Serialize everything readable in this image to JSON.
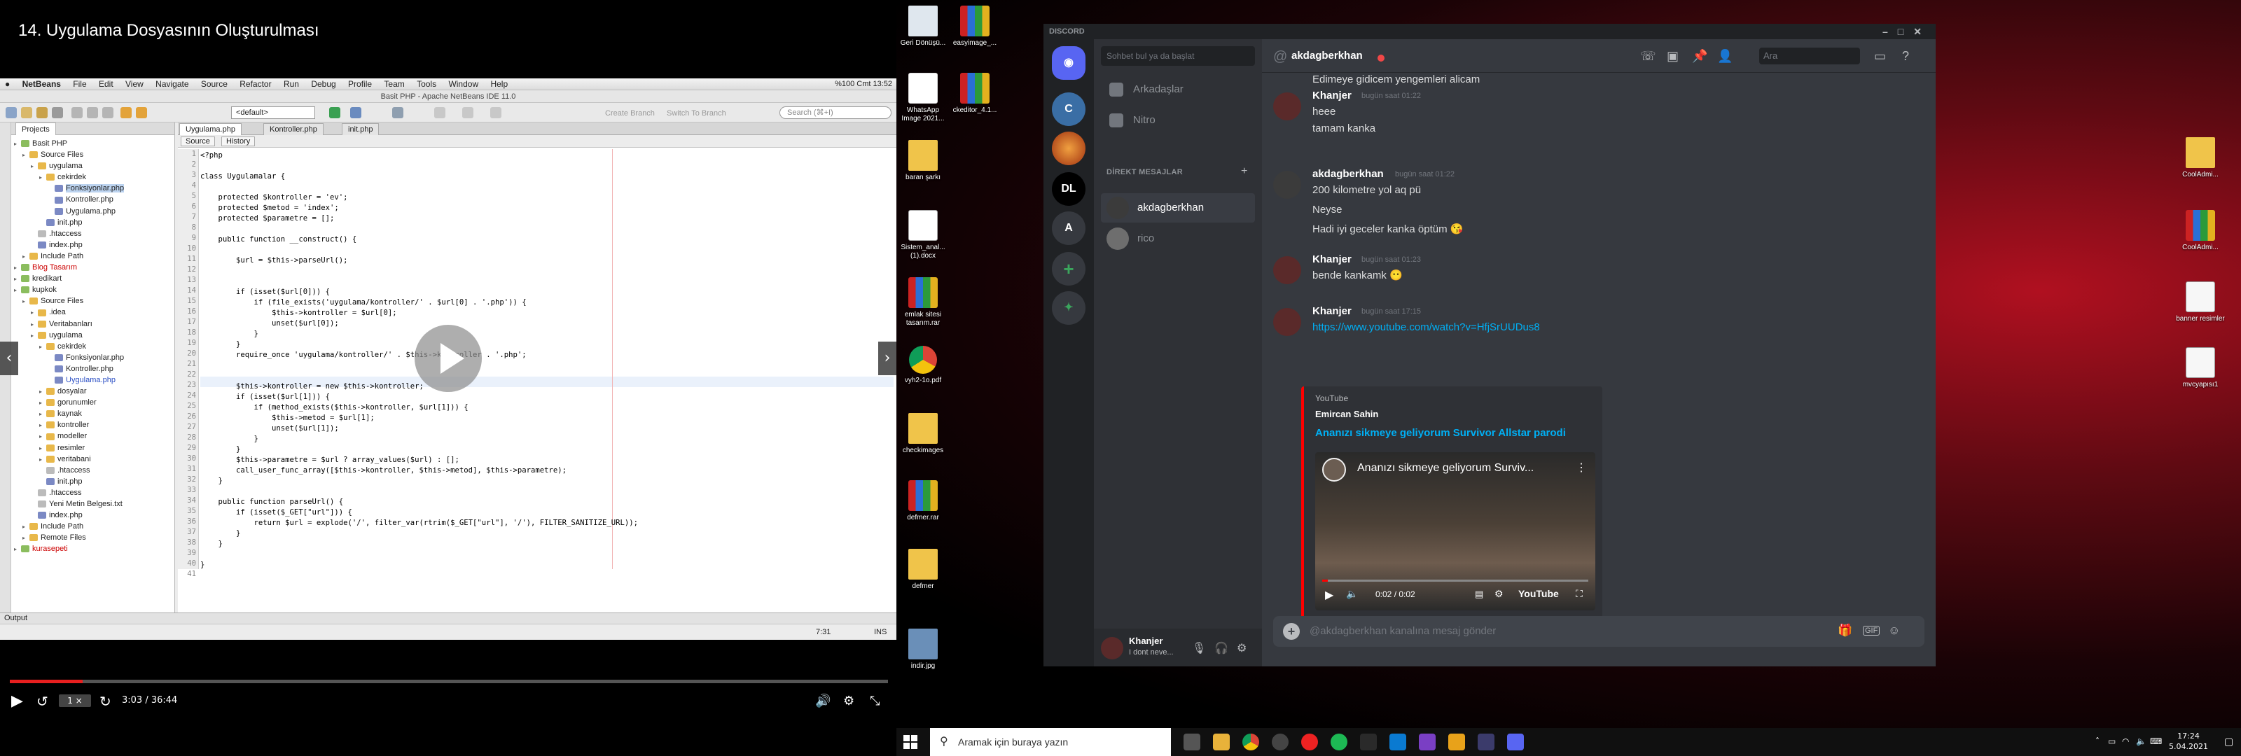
{
  "video": {
    "title": "14. Uygulama Dosyasının Oluşturulması",
    "speed": "1 ×",
    "time": "3:03 / 36:44",
    "progress": 0.083
  },
  "netbeans": {
    "menu": [
      "NetBeans",
      "File",
      "Edit",
      "View",
      "Navigate",
      "Source",
      "Refactor",
      "Run",
      "Debug",
      "Profile",
      "Team",
      "Tools",
      "Window",
      "Help"
    ],
    "sys_status": "%100  Cmt 13:52",
    "window_title": "Basit PHP - Apache NetBeans IDE 11.0",
    "config": "<default>",
    "search_placeholder": "Search (⌘+I)",
    "toolbar_text": [
      "Create Branch",
      "Switch To Branch"
    ],
    "project_tab": "Projects",
    "editor_tabs": [
      "Uygulama.php",
      "Kontroller.php",
      "init.php"
    ],
    "source_btn": "Source",
    "history_btn": "History",
    "tree": [
      {
        "t": "Basit PHP",
        "d": 0,
        "k": "proj"
      },
      {
        "t": "Source Files",
        "d": 1,
        "k": "folder"
      },
      {
        "t": "uygulama",
        "d": 2,
        "k": "folder"
      },
      {
        "t": "cekirdek",
        "d": 3,
        "k": "folder"
      },
      {
        "t": "Fonksiyonlar.php",
        "d": 4,
        "k": "php",
        "sel": true
      },
      {
        "t": "Kontroller.php",
        "d": 4,
        "k": "php"
      },
      {
        "t": "Uygulama.php",
        "d": 4,
        "k": "php"
      },
      {
        "t": "init.php",
        "d": 3,
        "k": "php"
      },
      {
        "t": ".htaccess",
        "d": 2,
        "k": "file"
      },
      {
        "t": "index.php",
        "d": 2,
        "k": "php"
      },
      {
        "t": "Include Path",
        "d": 1,
        "k": "folder"
      },
      {
        "t": "Blog Tasarım",
        "d": 0,
        "k": "proj",
        "red": true
      },
      {
        "t": "kredikart",
        "d": 0,
        "k": "proj"
      },
      {
        "t": "kupkok",
        "d": 0,
        "k": "proj"
      },
      {
        "t": "Source Files",
        "d": 1,
        "k": "folder"
      },
      {
        "t": ".idea",
        "d": 2,
        "k": "folder"
      },
      {
        "t": "Veritabanları",
        "d": 2,
        "k": "folder"
      },
      {
        "t": "uygulama",
        "d": 2,
        "k": "folder"
      },
      {
        "t": "cekirdek",
        "d": 3,
        "k": "folder"
      },
      {
        "t": "Fonksiyonlar.php",
        "d": 4,
        "k": "php"
      },
      {
        "t": "Kontroller.php",
        "d": 4,
        "k": "php"
      },
      {
        "t": "Uygulama.php",
        "d": 4,
        "k": "php",
        "blue": true
      },
      {
        "t": "dosyalar",
        "d": 3,
        "k": "folder"
      },
      {
        "t": "gorunumler",
        "d": 3,
        "k": "folder"
      },
      {
        "t": "kaynak",
        "d": 3,
        "k": "folder"
      },
      {
        "t": "kontroller",
        "d": 3,
        "k": "folder"
      },
      {
        "t": "modeller",
        "d": 3,
        "k": "folder"
      },
      {
        "t": "resimler",
        "d": 3,
        "k": "folder"
      },
      {
        "t": "veritabani",
        "d": 3,
        "k": "folder"
      },
      {
        "t": ".htaccess",
        "d": 3,
        "k": "file"
      },
      {
        "t": "init.php",
        "d": 3,
        "k": "php"
      },
      {
        "t": ".htaccess",
        "d": 2,
        "k": "file"
      },
      {
        "t": "Yeni Metin Belgesi.txt",
        "d": 2,
        "k": "file"
      },
      {
        "t": "index.php",
        "d": 2,
        "k": "php"
      },
      {
        "t": "Include Path",
        "d": 1,
        "k": "folder"
      },
      {
        "t": "Remote Files",
        "d": 1,
        "k": "folder"
      },
      {
        "t": "kurasepeti",
        "d": 0,
        "k": "proj",
        "red": true
      }
    ],
    "code_lines": [
      "<?php",
      "",
      "class Uygulamalar {",
      "",
      "    protected $kontroller = 'ev';",
      "    protected $metod = 'index';",
      "    protected $parametre = [];",
      "",
      "    public function __construct() {",
      "",
      "        $url = $this->parseUrl();",
      "",
      "",
      "        if (isset($url[0])) {",
      "            if (file_exists('uygulama/kontroller/' . $url[0] . '.php')) {",
      "                $this->kontroller = $url[0];",
      "                unset($url[0]);",
      "            }",
      "        }",
      "        require_once 'uygulama/kontroller/' . $this->kontroller . '.php';",
      "",
      "",
      "        $this->kontroller = new $this->kontroller;",
      "        if (isset($url[1])) {",
      "            if (method_exists($this->kontroller, $url[1])) {",
      "                $this->metod = $url[1];",
      "                unset($url[1]);",
      "            }",
      "        }",
      "        $this->parametre = $url ? array_values($url) : [];",
      "        call_user_func_array([$this->kontroller, $this->metod], $this->parametre);",
      "    }",
      "",
      "    public function parseUrl() {",
      "        if (isset($_GET[\"url\"])) {",
      "            return $url = explode('/', filter_var(rtrim($_GET[\"url\"], '/'), FILTER_SANITIZE_URL));",
      "        }",
      "    }",
      "",
      "}",
      ""
    ],
    "output_label": "Output",
    "cursor_pos": "7:31",
    "ins": "INS"
  },
  "desktop_icons": [
    {
      "label": "Geri Dönüşü...",
      "kind": "bin"
    },
    {
      "label": "easyimage_...",
      "kind": "rar"
    },
    {
      "label": "WhatsApp Image 2021...",
      "kind": "pdf"
    },
    {
      "label": "ckeditor_4.1...",
      "kind": "rar"
    },
    {
      "label": "baran şarkı",
      "kind": "folder"
    },
    {
      "label": "Sistem_anal... (1).docx",
      "kind": "doc"
    },
    {
      "label": "emlak sitesi tasarım.rar",
      "kind": "rar"
    },
    {
      "label": "vyh2-1o.pdf",
      "kind": "chrome"
    },
    {
      "label": "checkimages",
      "kind": "folder"
    },
    {
      "label": "defmer.rar",
      "kind": "rar"
    },
    {
      "label": "defmer",
      "kind": "folder"
    },
    {
      "label": "indir.jpg",
      "kind": "jpg"
    },
    {
      "label": "CoolAdmi...",
      "kind": "folder"
    },
    {
      "label": "CoolAdmi...",
      "kind": "rar"
    },
    {
      "label": "banner resimler",
      "kind": "txt"
    },
    {
      "label": "mvcyapısı1",
      "kind": "txt"
    }
  ],
  "discord": {
    "titlebar": "DISCORD",
    "search": "Sohbet bul ya da başlat",
    "nav": [
      "Arkadaşlar",
      "Nitro"
    ],
    "dm_header": "DİREKT MESAJLAR",
    "dms": [
      {
        "name": "akdagberkhan",
        "color": "#3b3b3b",
        "sel": true
      },
      {
        "name": "rico",
        "color": "#6e6e6e",
        "sel": false
      }
    ],
    "guild_labels": [
      "DL"
    ],
    "user": {
      "name": "Khanjer",
      "status": "I dont neve..."
    },
    "channel": "akdagberkhan",
    "top_search": "Ara",
    "messages": [
      {
        "partial": "Edimeye gidicem yengemleri alicam"
      },
      {
        "author": "Khanjer",
        "time": "bugün saat 01:22",
        "lines": [
          "heee",
          "tamam kanka"
        ],
        "av": "#5a2a2a"
      },
      {
        "author": "akdagberkhan",
        "time": "bugün saat 01:22",
        "lines": [
          "200 kilometre yol aq pü",
          "Neyse",
          "Hadi iyi geceler kanka öptüm 😘"
        ],
        "av": "#3b3b3b"
      },
      {
        "author": "Khanjer",
        "time": "bugün saat 01:23",
        "lines": [
          "bende kankamk 😶"
        ],
        "av": "#5a2a2a"
      },
      {
        "author": "Khanjer",
        "time": "bugün saat 17:15",
        "lines": [
          "https://www.youtube.com/watch?v=HfjSrUUDus8"
        ],
        "av": "#5a2a2a"
      }
    ],
    "embed": {
      "provider": "YouTube",
      "author": "Emircan Sahin",
      "title": "Ananızı sikmeye geliyorum Survivor Allstar parodi",
      "video_title": "Ananızı sikmeye geliyorum Surviv...",
      "time": "0:02 / 0:02",
      "yt": "YouTube",
      "progress": 0.02
    },
    "input_placeholder": "@akdagberkhan kanalına mesaj gönder",
    "gif": "GIF"
  },
  "taskbar": {
    "search": "Aramak için buraya yazın",
    "time": "17:24",
    "date": "5.04.2021"
  }
}
